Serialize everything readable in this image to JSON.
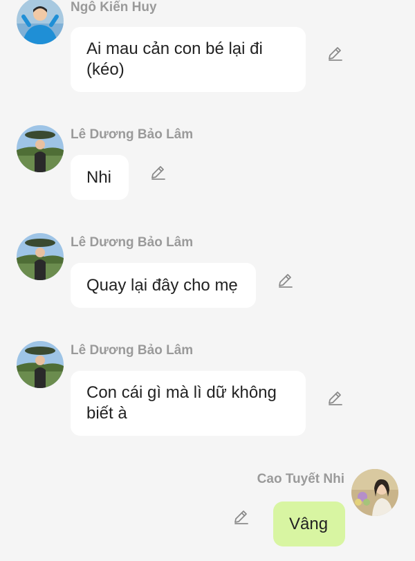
{
  "messages": [
    {
      "sender": "Ngô Kiến Huy",
      "text": "Ai mau cản con bé lại đi (kéo)",
      "avatar_icon": "user-avatar-photo",
      "edit_icon": "pencil-icon"
    },
    {
      "sender": "Lê Dương Bảo Lâm",
      "text": "Nhi",
      "avatar_icon": "user-avatar-photo",
      "edit_icon": "pencil-icon"
    },
    {
      "sender": "Lê Dương Bảo Lâm",
      "text": "Quay lại đây cho mẹ",
      "avatar_icon": "user-avatar-photo",
      "edit_icon": "pencil-icon"
    },
    {
      "sender": "Lê Dương Bảo Lâm",
      "text": "Con cái gì mà lì dữ không biết à",
      "avatar_icon": "user-avatar-photo",
      "edit_icon": "pencil-icon"
    },
    {
      "sender": "Cao Tuyết Nhi",
      "text": "Vâng",
      "avatar_icon": "user-avatar-photo",
      "edit_icon": "pencil-icon",
      "own": true
    }
  ],
  "colors": {
    "background": "#f5f5f5",
    "bubble_incoming": "#ffffff",
    "bubble_outgoing": "#d8f5a2",
    "sender_name": "#9a9a9a",
    "message_text": "#222222",
    "edit_icon": "#8a8a8a"
  }
}
